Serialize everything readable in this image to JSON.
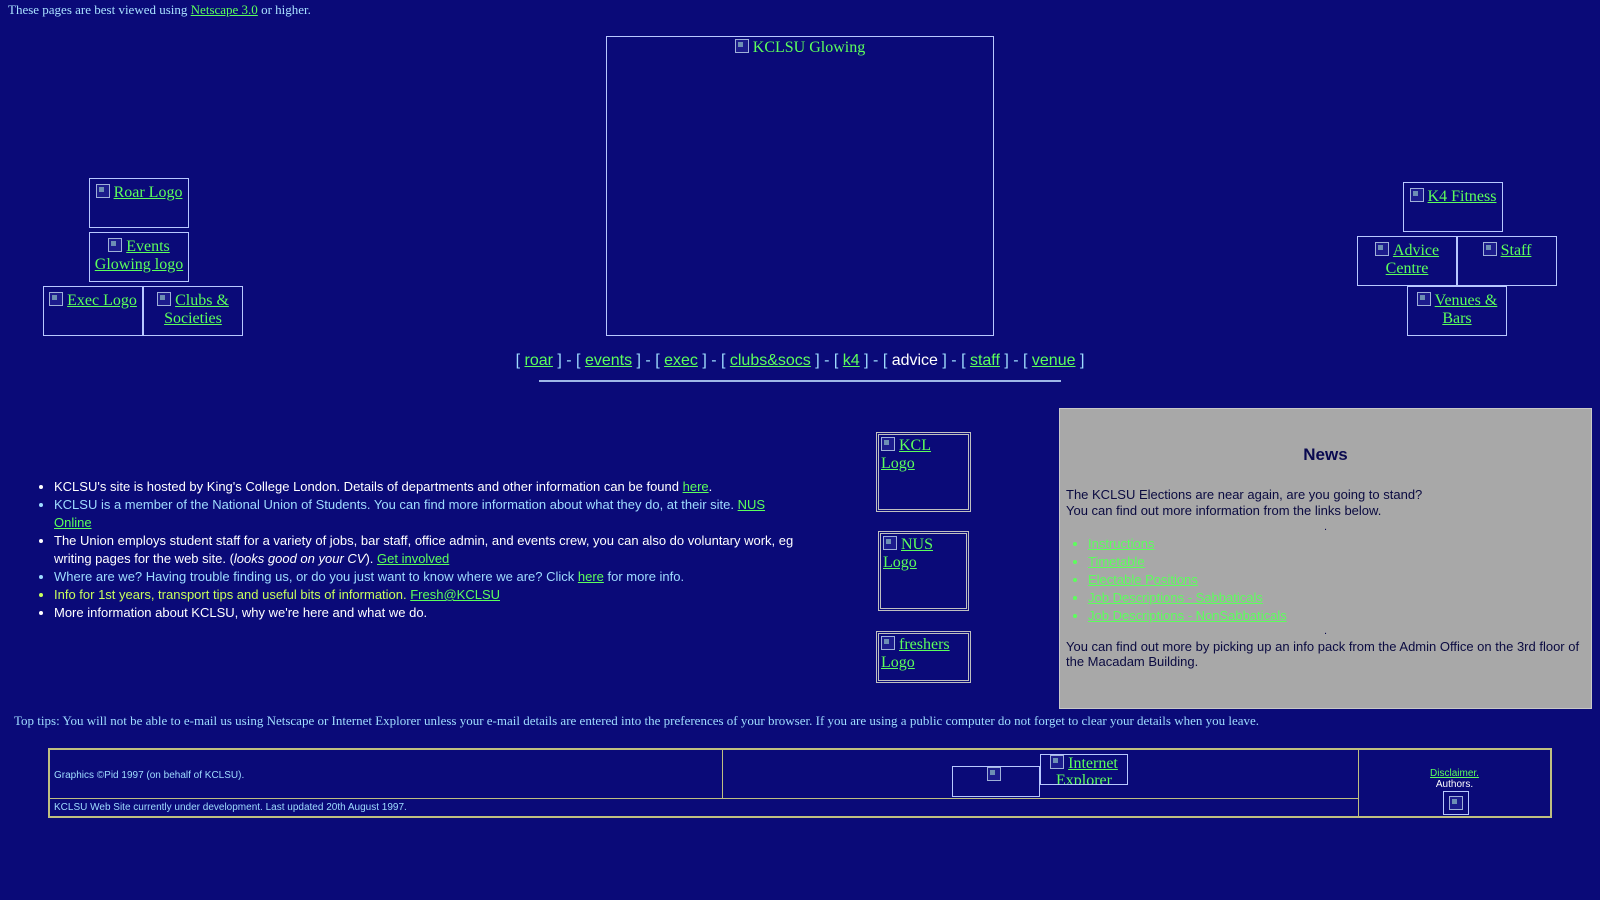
{
  "top_notice": {
    "before": "These pages are best viewed using ",
    "link": "Netscape 3.0",
    "after": " or higher."
  },
  "images": {
    "banner": "KCLSU Glowing",
    "roar": "Roar Logo",
    "events": "Events Glowing logo",
    "exec": "Exec Logo",
    "clubs": "Clubs & Societies",
    "k4": "K4 Fitness",
    "advice": "Advice Centre",
    "staff": "Staff",
    "venues": "Venues & Bars",
    "kcl": "KCL Logo",
    "nus": "NUS Logo",
    "freshers": "freshers Logo",
    "ie": "Internet Explorer"
  },
  "nav": {
    "items": [
      "roar",
      "events",
      "exec",
      "clubs&socs",
      "k4",
      "advice",
      "staff",
      "venue"
    ],
    "current": "advice",
    "open": "[ ",
    "close": " ]",
    "sep": " ] - [ "
  },
  "info_list": [
    {
      "text": "KCLSU's site is hosted by King's College London. Details of departments and other information can be found ",
      "link": "here",
      "after": "."
    },
    {
      "text": "KCLSU is a member of the National Union of Students. You can find more information about what they do, at their site. ",
      "link": "NUS Online",
      "after": ""
    },
    {
      "text": "The Union employs student staff for a variety of jobs, bar staff, office admin, and events crew, you can also do voluntary work, eg writing pages for the web site. (",
      "italic": "looks good on your CV",
      "text2": "). ",
      "link": "Get involved",
      "after": ""
    },
    {
      "text": "Where are we? Having trouble finding us, or do you just want to know where we are? Click ",
      "link": "here",
      "after": " for more info."
    },
    {
      "text": "Info for 1st years, transport tips and useful bits of information. ",
      "link": "Fresh@KCLSU",
      "after": ""
    },
    {
      "text": "More information about KCLSU, why we're here and what we do.",
      "link": "",
      "after": ""
    }
  ],
  "news": {
    "title": "News",
    "line1": "The KCLSU Elections are near again, are you going to stand?",
    "line2": "You can find out more information from the links below.",
    "dot": ".",
    "links": [
      "Instructions",
      "Timetable",
      "Electable Positions",
      "Job Descriptions - Sabbaticals",
      "Job Descriptions - NonSabbaticals"
    ],
    "footer": "You can find out more by picking up an info pack from the Admin Office on the 3rd floor of the Macadam Building."
  },
  "tips": "Top tips: You will not be able to e-mail us using Netscape or Internet Explorer unless your e-mail details are entered into the preferences of your browser. If you are using a public computer do not forget to clear your details when you leave.",
  "footer": {
    "graphics": "Graphics ©Pid 1997 (on behalf of KCLSU).",
    "status": "KCLSU Web Site currently under development. Last updated 20th August 1997.",
    "disclaimer": "Disclaimer.",
    "authors": "Authors."
  },
  "colors": {
    "background": "#0a0a78",
    "link": "#5cff5c",
    "text": "#9fdcff",
    "news_panel": "#a8a8a8"
  }
}
